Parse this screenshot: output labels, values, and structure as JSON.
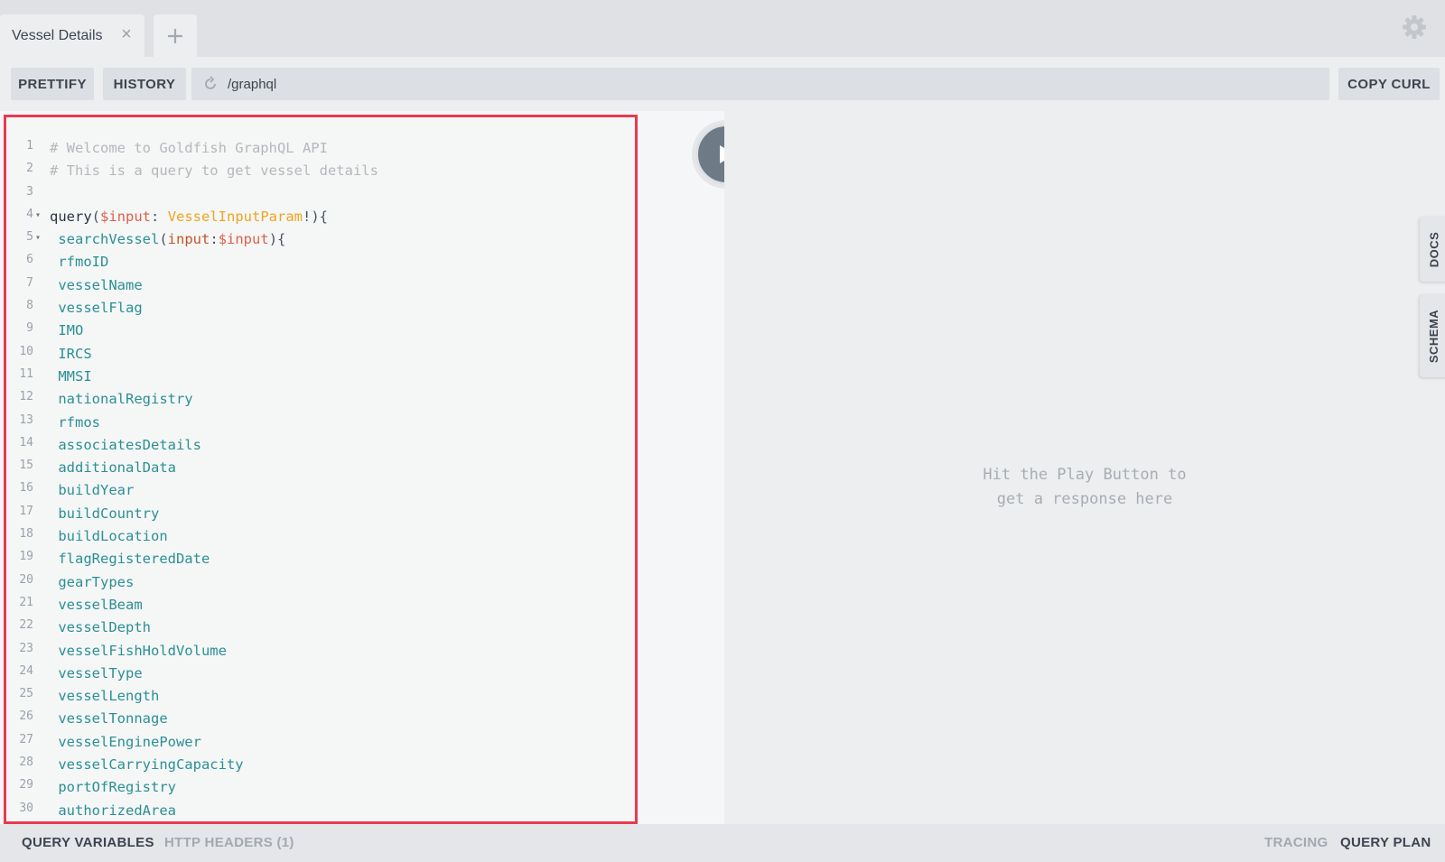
{
  "tabs": [
    {
      "title": "Vessel Details",
      "close_icon": "close-icon"
    }
  ],
  "add_tab_icon": "plus-icon",
  "settings_icon": "gear-icon",
  "toolbar": {
    "prettify_label": "PRETTIFY",
    "history_label": "HISTORY",
    "url": "/graphql",
    "copy_curl_label": "COPY CURL"
  },
  "editor": {
    "lines": [
      {
        "n": "1",
        "fold": "",
        "text": "# Welcome to Goldfish GraphQL API",
        "kind": "comment"
      },
      {
        "n": "2",
        "fold": "",
        "text": "# This is a query to get vessel details",
        "kind": "comment"
      },
      {
        "n": "3",
        "fold": "",
        "text": "",
        "kind": "blank"
      },
      {
        "n": "4",
        "fold": "▾",
        "text": "query($input: VesselInputParam!){",
        "kind": "query"
      },
      {
        "n": "5",
        "fold": "▾",
        "text": " searchVessel(input:$input){",
        "kind": "call"
      },
      {
        "n": "6",
        "fold": "",
        "text": " rfmoID",
        "kind": "field"
      },
      {
        "n": "7",
        "fold": "",
        "text": " vesselName",
        "kind": "field"
      },
      {
        "n": "8",
        "fold": "",
        "text": " vesselFlag",
        "kind": "field"
      },
      {
        "n": "9",
        "fold": "",
        "text": " IMO",
        "kind": "field"
      },
      {
        "n": "10",
        "fold": "",
        "text": " IRCS",
        "kind": "field"
      },
      {
        "n": "11",
        "fold": "",
        "text": " MMSI",
        "kind": "field"
      },
      {
        "n": "12",
        "fold": "",
        "text": " nationalRegistry",
        "kind": "field"
      },
      {
        "n": "13",
        "fold": "",
        "text": " rfmos",
        "kind": "field"
      },
      {
        "n": "14",
        "fold": "",
        "text": " associatesDetails",
        "kind": "field"
      },
      {
        "n": "15",
        "fold": "",
        "text": " additionalData",
        "kind": "field"
      },
      {
        "n": "16",
        "fold": "",
        "text": " buildYear",
        "kind": "field"
      },
      {
        "n": "17",
        "fold": "",
        "text": " buildCountry",
        "kind": "field"
      },
      {
        "n": "18",
        "fold": "",
        "text": " buildLocation",
        "kind": "field"
      },
      {
        "n": "19",
        "fold": "",
        "text": " flagRegisteredDate",
        "kind": "field"
      },
      {
        "n": "20",
        "fold": "",
        "text": " gearTypes",
        "kind": "field"
      },
      {
        "n": "21",
        "fold": "",
        "text": " vesselBeam",
        "kind": "field"
      },
      {
        "n": "22",
        "fold": "",
        "text": " vesselDepth",
        "kind": "field"
      },
      {
        "n": "23",
        "fold": "",
        "text": " vesselFishHoldVolume",
        "kind": "field"
      },
      {
        "n": "24",
        "fold": "",
        "text": " vesselType",
        "kind": "field"
      },
      {
        "n": "25",
        "fold": "",
        "text": " vesselLength",
        "kind": "field"
      },
      {
        "n": "26",
        "fold": "",
        "text": " vesselTonnage",
        "kind": "field"
      },
      {
        "n": "27",
        "fold": "",
        "text": " vesselEnginePower",
        "kind": "field"
      },
      {
        "n": "28",
        "fold": "",
        "text": " vesselCarryingCapacity",
        "kind": "field"
      },
      {
        "n": "29",
        "fold": "",
        "text": " portOfRegistry",
        "kind": "field"
      },
      {
        "n": "30",
        "fold": "",
        "text": " authorizedArea",
        "kind": "field"
      }
    ]
  },
  "play_icon": "play-icon",
  "result": {
    "hint_line1": "Hit the Play Button to",
    "hint_line2": "get a response here"
  },
  "sidetabs": {
    "docs": "DOCS",
    "schema": "SCHEMA"
  },
  "bottom": {
    "query_variables": "QUERY VARIABLES",
    "http_headers": "HTTP HEADERS (1)",
    "tracing": "TRACING",
    "query_plan": "QUERY PLAN"
  },
  "colors": {
    "highlight_border": "#e83a4f",
    "field": "#2b8f95",
    "comment": "#b4b8bd",
    "variable": "#e05f4a",
    "type": "#f0a420"
  }
}
